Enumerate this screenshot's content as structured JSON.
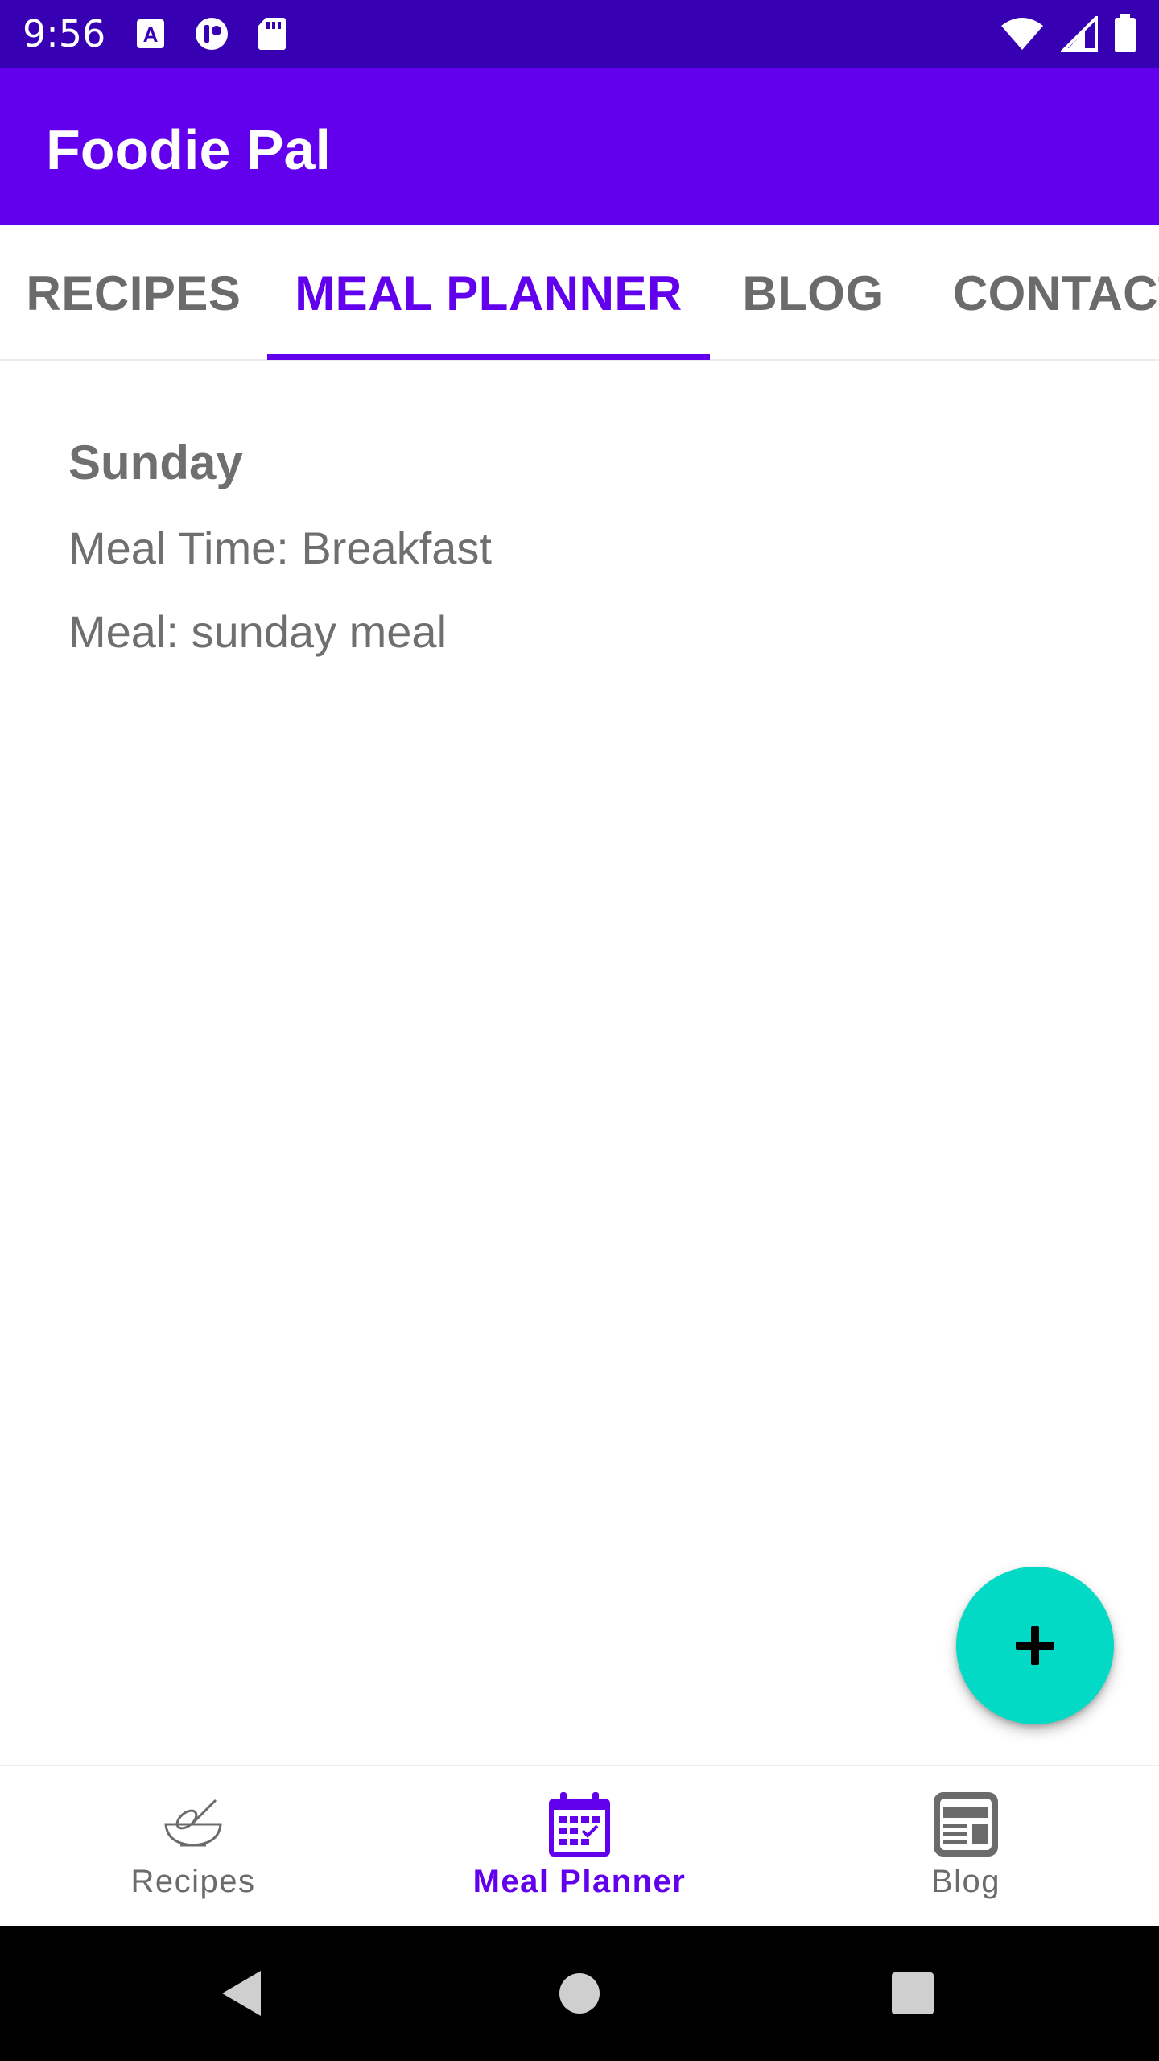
{
  "status_bar": {
    "time": "9:56",
    "left_icons": [
      "a-accessibility-icon",
      "pocket-icon",
      "sd-card-icon"
    ],
    "right_icons": [
      "wifi-icon",
      "cell-signal-icon",
      "battery-icon"
    ]
  },
  "app_bar": {
    "title": "Foodie Pal"
  },
  "tabs": [
    {
      "label": "RECIPES",
      "active": false
    },
    {
      "label": "MEAL PLANNER",
      "active": true
    },
    {
      "label": "BLOG",
      "active": false
    },
    {
      "label": "CONTACT",
      "active": false
    }
  ],
  "meal": {
    "day": "Sunday",
    "time_line": "Meal Time: Breakfast",
    "meal_line": "Meal: sunday meal"
  },
  "fab": {
    "icon": "plus-icon"
  },
  "bottom_nav": [
    {
      "label": "Recipes",
      "icon": "whisk-bowl-icon",
      "active": false
    },
    {
      "label": "Meal Planner",
      "icon": "calendar-icon",
      "active": true
    },
    {
      "label": "Blog",
      "icon": "blog-icon",
      "active": false
    }
  ],
  "colors": {
    "primary": "#6200ee",
    "primary_dark": "#3700b3",
    "accent": "#03dac5"
  }
}
